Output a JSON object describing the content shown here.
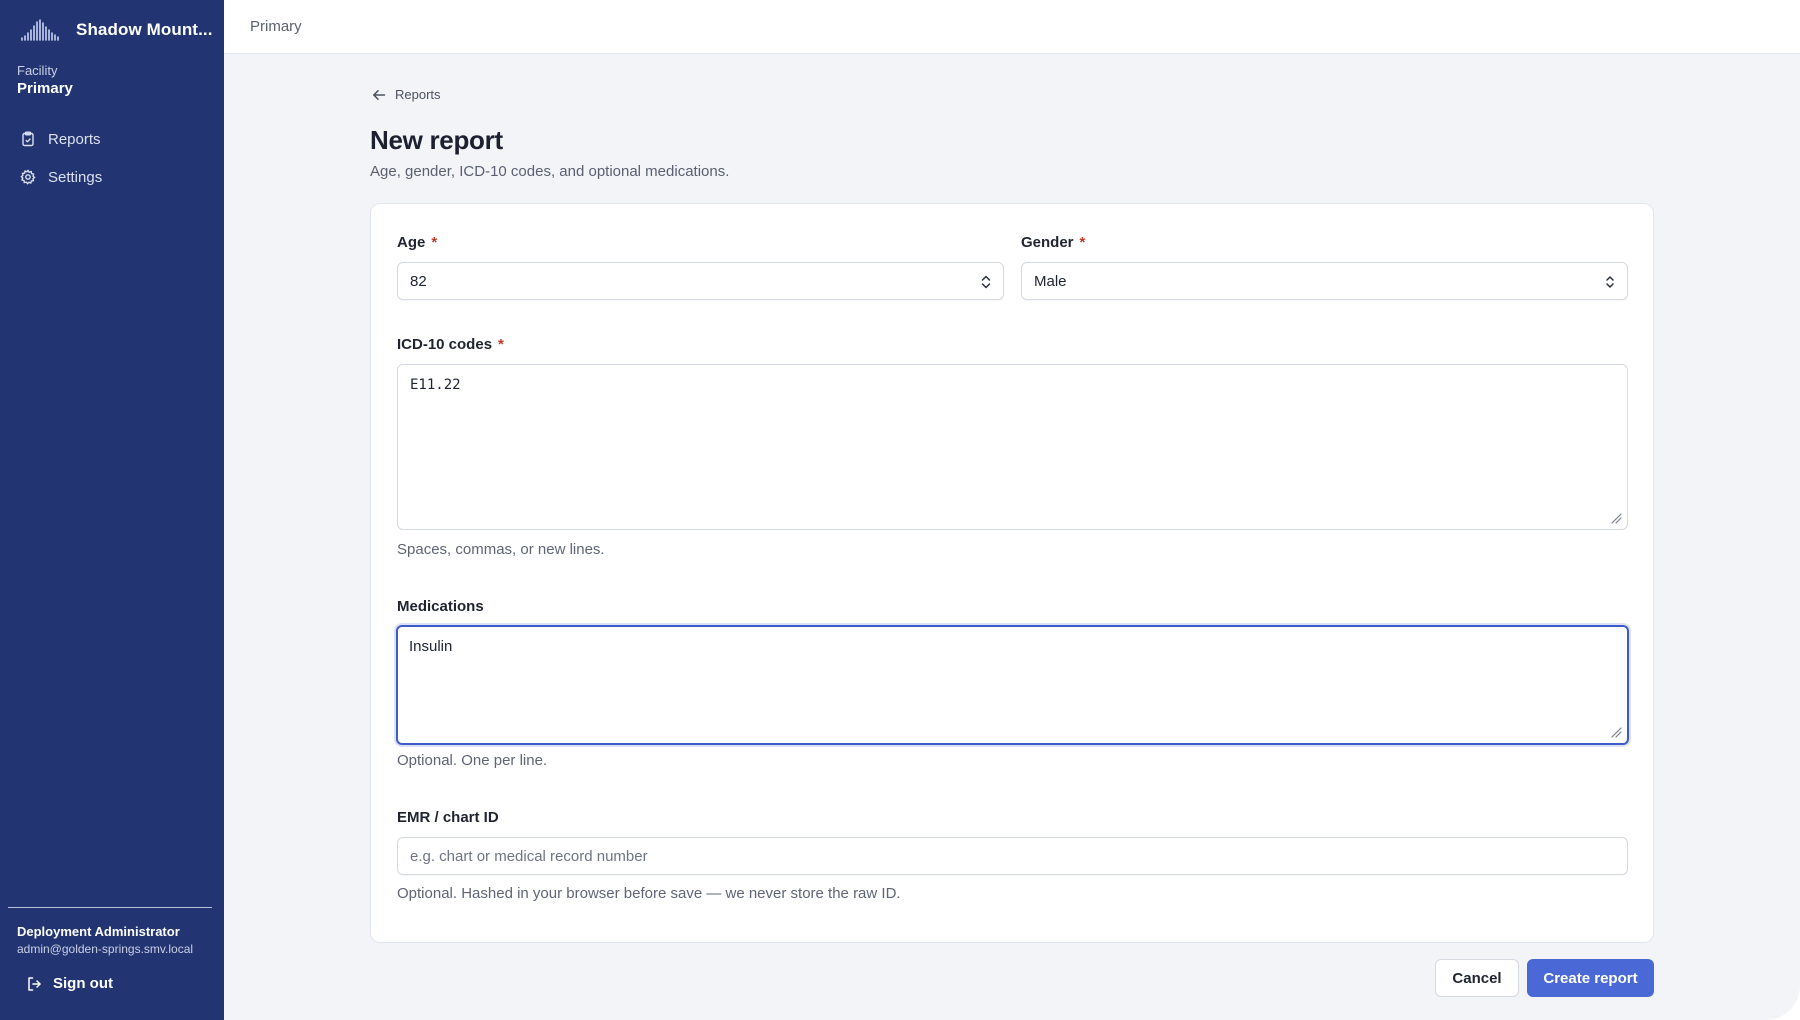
{
  "sidebar": {
    "brand_name": "Shadow Mount...",
    "facility_label": "Facility",
    "facility_value": "Primary",
    "nav": [
      {
        "label": "Reports",
        "icon": "clipboard-icon"
      },
      {
        "label": "Settings",
        "icon": "gear-icon"
      }
    ],
    "user_name": "Deployment Administrator",
    "user_email": "admin@golden-springs.smv.local",
    "signout_label": "Sign out"
  },
  "topbar": {
    "title": "Primary"
  },
  "page": {
    "back_label": "Reports",
    "title": "New report",
    "subtitle": "Age, gender, ICD-10 codes, and optional medications."
  },
  "form": {
    "age": {
      "label": "Age",
      "required_mark": "*",
      "value": "82"
    },
    "gender": {
      "label": "Gender",
      "required_mark": "*",
      "value": "Male"
    },
    "icd": {
      "label": "ICD-10 codes",
      "required_mark": "*",
      "value": "E11.22",
      "hint": "Spaces, commas, or new lines."
    },
    "medications": {
      "label": "Medications",
      "value": "Insulin",
      "hint": "Optional. One per line."
    },
    "emr": {
      "label": "EMR / chart ID",
      "placeholder": "e.g. chart or medical record number",
      "hint": "Optional. Hashed in your browser before save — we never store the raw ID."
    }
  },
  "actions": {
    "cancel_label": "Cancel",
    "create_label": "Create report"
  },
  "colors": {
    "sidebar": "#233472",
    "accent": "#4a69d6",
    "required": "#c0392b"
  }
}
